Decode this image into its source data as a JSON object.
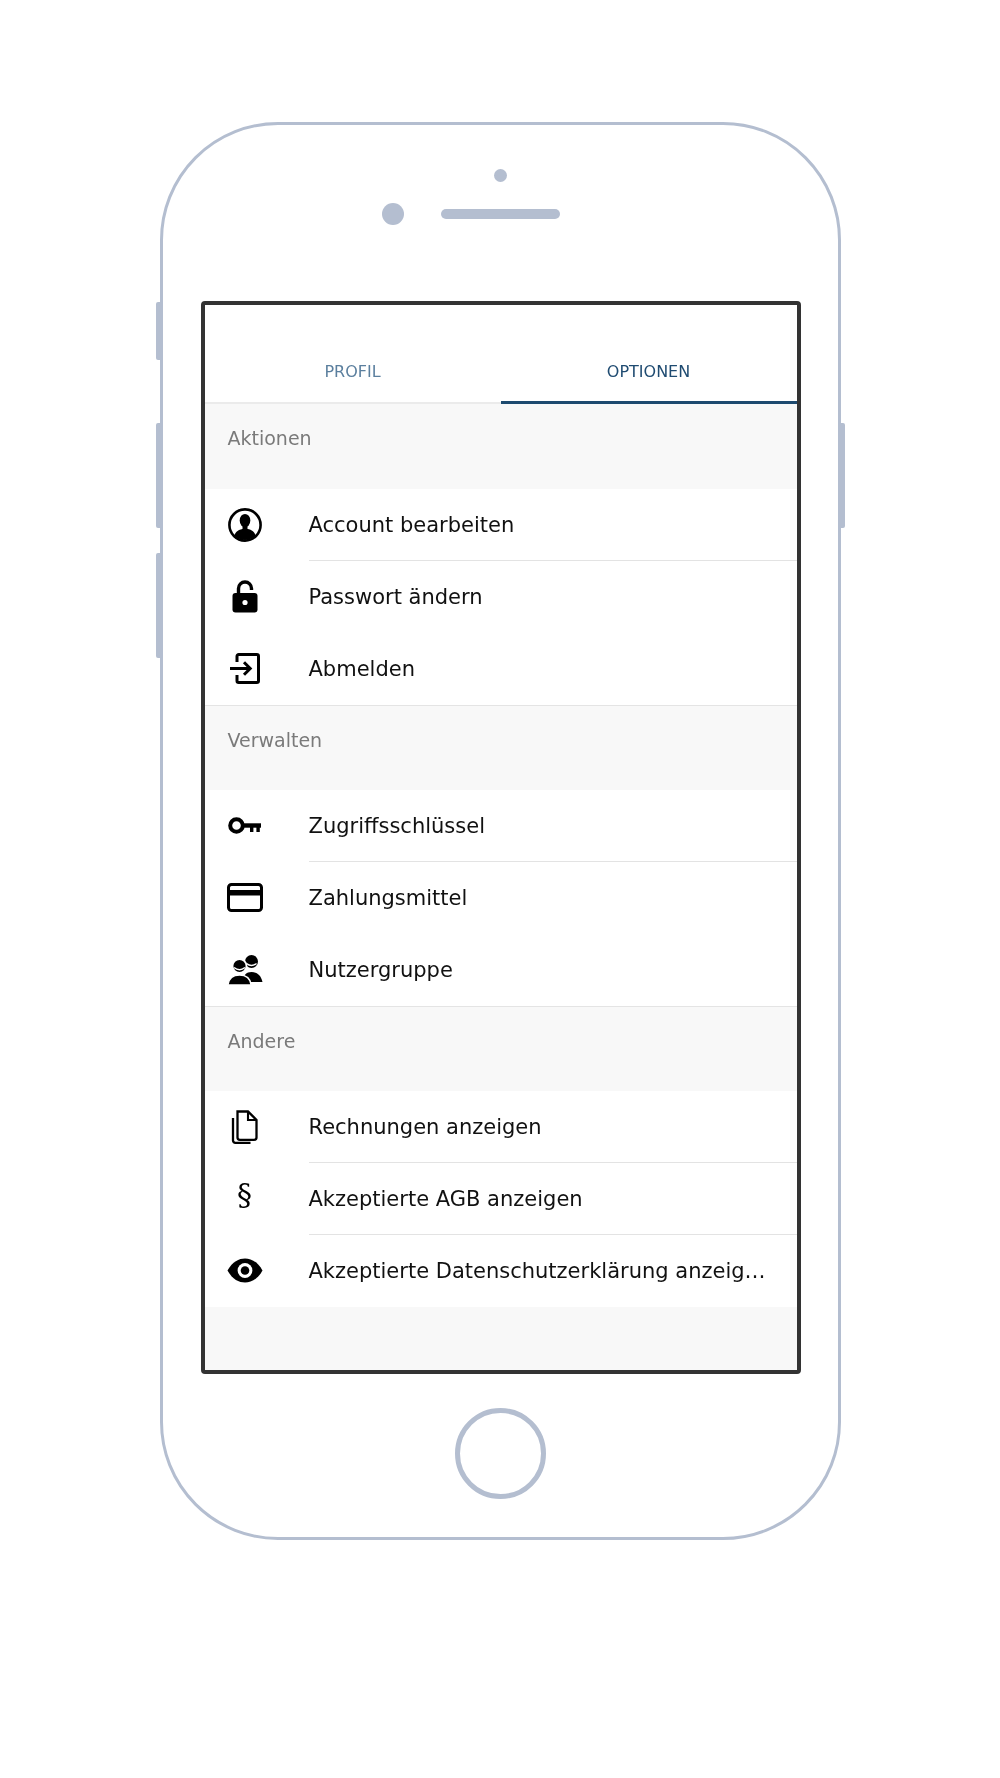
{
  "tabs": [
    {
      "label": "PROFIL",
      "selected": false
    },
    {
      "label": "OPTIONEN",
      "selected": true
    }
  ],
  "sections": [
    {
      "title": "Aktionen",
      "items": [
        {
          "label": "Account bearbeiten",
          "divider": true
        },
        {
          "label": "Passwort ändern",
          "divider": false
        },
        {
          "label": "Abmelden",
          "divider": false
        }
      ]
    },
    {
      "title": "Verwalten",
      "items": [
        {
          "label": "Zugriffsschlüssel",
          "divider": true
        },
        {
          "label": "Zahlungsmittel",
          "divider": false
        },
        {
          "label": "Nutzergruppe",
          "divider": false
        }
      ]
    },
    {
      "title": "Andere",
      "items": [
        {
          "label": "Rechnungen anzeigen",
          "divider": true
        },
        {
          "glyph": "§",
          "label": "Akzeptierte AGB anzeigen",
          "divider": true
        },
        {
          "label": "Akzeptierte Datenschutzerklärung anzeig…",
          "divider": false
        }
      ]
    }
  ]
}
